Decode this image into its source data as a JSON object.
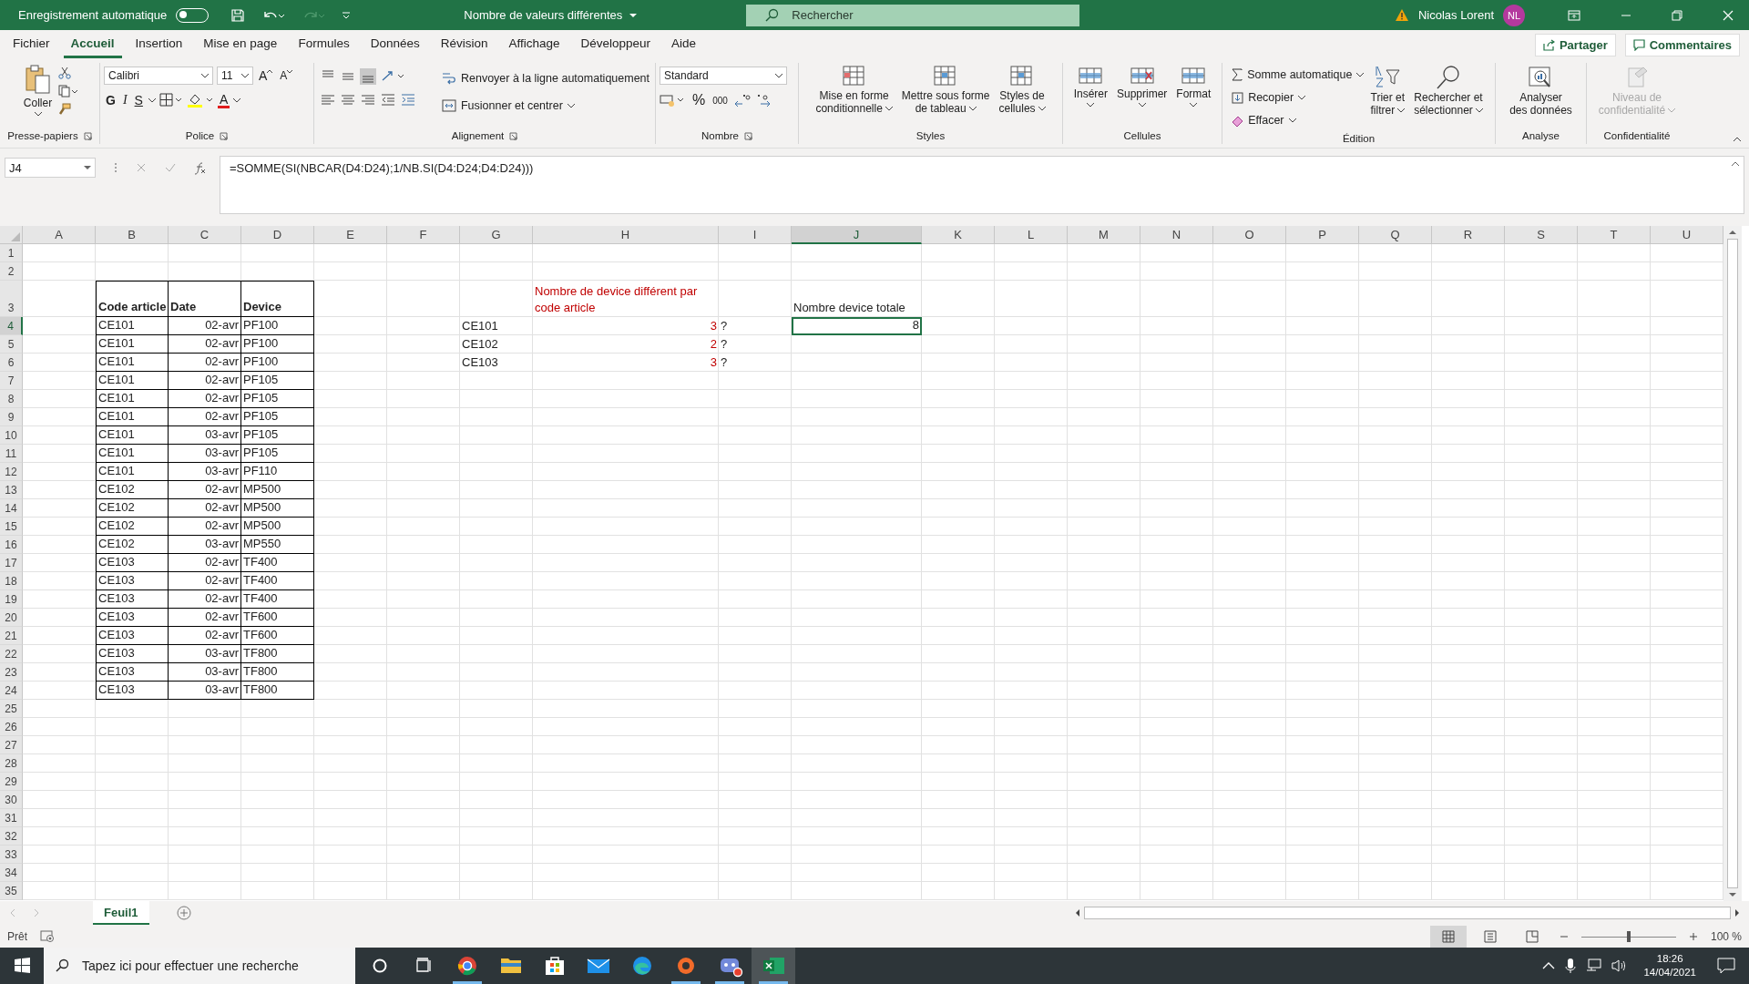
{
  "title_bar": {
    "autosave_label": "Enregistrement automatique",
    "autosave_on": false,
    "title": "Nombre de valeurs différentes",
    "search_placeholder": "Rechercher",
    "user_name": "Nicolas Lorent",
    "user_initials": "NL"
  },
  "menu_tabs": [
    {
      "label": "Fichier",
      "selected": false
    },
    {
      "label": "Accueil",
      "selected": true
    },
    {
      "label": "Insertion",
      "selected": false
    },
    {
      "label": "Mise en page",
      "selected": false
    },
    {
      "label": "Formules",
      "selected": false
    },
    {
      "label": "Données",
      "selected": false
    },
    {
      "label": "Révision",
      "selected": false
    },
    {
      "label": "Affichage",
      "selected": false
    },
    {
      "label": "Développeur",
      "selected": false
    },
    {
      "label": "Aide",
      "selected": false
    }
  ],
  "share_button": "Partager",
  "comments_button": "Commentaires",
  "ribbon": {
    "clipboard": {
      "paste": "Coller",
      "label": "Presse-papiers"
    },
    "font": {
      "family": "Calibri",
      "size": "11",
      "grow": "A",
      "shrink": "A",
      "bold": "G",
      "italic": "I",
      "underline": "S",
      "font_color": "A",
      "label": "Police"
    },
    "alignment": {
      "wrap": "Renvoyer à la ligne automatiquement",
      "merge": "Fusionner et centrer",
      "label": "Alignement"
    },
    "number": {
      "format": "Standard",
      "percent": "%",
      "thousands": "000",
      "label": "Nombre"
    },
    "styles": {
      "buttons": [
        {
          "lines": [
            "Mise en forme",
            "conditionnelle"
          ]
        },
        {
          "lines": [
            "Mettre sous forme",
            "de tableau"
          ]
        },
        {
          "lines": [
            "Styles de",
            "cellules"
          ]
        }
      ],
      "label": "Styles"
    },
    "cells": {
      "buttons": [
        "Insérer",
        "Supprimer",
        "Format"
      ],
      "label": "Cellules"
    },
    "editing": {
      "autosum": "Somme automatique",
      "fill": "Recopier",
      "clear": "Effacer",
      "sort": [
        "Trier et",
        "filtrer"
      ],
      "find": [
        "Rechercher et",
        "sélectionner"
      ],
      "label": "Édition"
    },
    "analysis": {
      "button": [
        "Analyser",
        "des données"
      ],
      "label": "Analyse"
    },
    "confidentiality": {
      "button": [
        "Niveau de",
        "confidentialité"
      ],
      "disabled": true,
      "label": "Confidentialité"
    }
  },
  "formula_bar": {
    "name_box": "J4",
    "formula": "=SOMME(SI(NBCAR(D4:D24);1/NB.SI(D4:D24;D4:D24)))"
  },
  "sheet": {
    "columns": [
      {
        "label": "A",
        "selected": false
      },
      {
        "label": "B",
        "selected": false
      },
      {
        "label": "C",
        "selected": false
      },
      {
        "label": "D",
        "selected": false
      },
      {
        "label": "E",
        "selected": false
      },
      {
        "label": "F",
        "selected": false
      },
      {
        "label": "G",
        "selected": false
      },
      {
        "label": "H",
        "selected": false
      },
      {
        "label": "I",
        "selected": false
      },
      {
        "label": "J",
        "selected": true
      },
      {
        "label": "K",
        "selected": false
      },
      {
        "label": "L",
        "selected": false
      },
      {
        "label": "M",
        "selected": false
      },
      {
        "label": "N",
        "selected": false
      },
      {
        "label": "O",
        "selected": false
      },
      {
        "label": "P",
        "selected": false
      },
      {
        "label": "Q",
        "selected": false
      },
      {
        "label": "R",
        "selected": false
      },
      {
        "label": "S",
        "selected": false
      },
      {
        "label": "T",
        "selected": false
      },
      {
        "label": "U",
        "selected": false
      }
    ],
    "rows": [
      {
        "header": "1",
        "selected": false
      },
      {
        "header": "2",
        "selected": false
      },
      {
        "header": "3",
        "selected": false
      },
      {
        "header": "4",
        "selected": true
      },
      {
        "header": "5",
        "selected": false
      },
      {
        "header": "6",
        "selected": false
      },
      {
        "header": "7",
        "selected": false
      },
      {
        "header": "8",
        "selected": false
      },
      {
        "header": "9",
        "selected": false
      },
      {
        "header": "10",
        "selected": false
      },
      {
        "header": "11",
        "selected": false
      },
      {
        "header": "12",
        "selected": false
      },
      {
        "header": "13",
        "selected": false
      },
      {
        "header": "14",
        "selected": false
      },
      {
        "header": "15",
        "selected": false
      },
      {
        "header": "16",
        "selected": false
      },
      {
        "header": "17",
        "selected": false
      },
      {
        "header": "18",
        "selected": false
      },
      {
        "header": "19",
        "selected": false
      },
      {
        "header": "20",
        "selected": false
      },
      {
        "header": "21",
        "selected": false
      },
      {
        "header": "22",
        "selected": false
      },
      {
        "header": "23",
        "selected": false
      },
      {
        "header": "24",
        "selected": false
      },
      {
        "header": "25",
        "selected": false
      },
      {
        "header": "26",
        "selected": false
      },
      {
        "header": "27",
        "selected": false
      },
      {
        "header": "28",
        "selected": false
      },
      {
        "header": "29",
        "selected": false
      },
      {
        "header": "30",
        "selected": false
      },
      {
        "header": "31",
        "selected": false
      },
      {
        "header": "32",
        "selected": false
      },
      {
        "header": "33",
        "selected": false
      },
      {
        "header": "34",
        "selected": false
      },
      {
        "header": "35",
        "selected": false
      }
    ],
    "data_table": {
      "headers": [
        "Code article",
        "Date",
        "Device"
      ],
      "rows": [
        {
          "code": "CE101",
          "date": "02-avr",
          "device": "PF100"
        },
        {
          "code": "CE101",
          "date": "02-avr",
          "device": "PF100"
        },
        {
          "code": "CE101",
          "date": "02-avr",
          "device": "PF100"
        },
        {
          "code": "CE101",
          "date": "02-avr",
          "device": "PF105"
        },
        {
          "code": "CE101",
          "date": "02-avr",
          "device": "PF105"
        },
        {
          "code": "CE101",
          "date": "02-avr",
          "device": "PF105"
        },
        {
          "code": "CE101",
          "date": "03-avr",
          "device": "PF105"
        },
        {
          "code": "CE101",
          "date": "03-avr",
          "device": "PF105"
        },
        {
          "code": "CE101",
          "date": "03-avr",
          "device": "PF110"
        },
        {
          "code": "CE102",
          "date": "02-avr",
          "device": "MP500"
        },
        {
          "code": "CE102",
          "date": "02-avr",
          "device": "MP500"
        },
        {
          "code": "CE102",
          "date": "02-avr",
          "device": "MP500"
        },
        {
          "code": "CE102",
          "date": "03-avr",
          "device": "MP550"
        },
        {
          "code": "CE103",
          "date": "02-avr",
          "device": "TF400"
        },
        {
          "code": "CE103",
          "date": "02-avr",
          "device": "TF400"
        },
        {
          "code": "CE103",
          "date": "02-avr",
          "device": "TF400"
        },
        {
          "code": "CE103",
          "date": "02-avr",
          "device": "TF600"
        },
        {
          "code": "CE103",
          "date": "02-avr",
          "device": "TF600"
        },
        {
          "code": "CE103",
          "date": "03-avr",
          "device": "TF800"
        },
        {
          "code": "CE103",
          "date": "03-avr",
          "device": "TF800"
        },
        {
          "code": "CE103",
          "date": "03-avr",
          "device": "TF800"
        }
      ]
    },
    "distinct_counts": {
      "title": "Nombre de device différent par code article",
      "rows": [
        {
          "code": "CE101",
          "count": "3",
          "note": "?"
        },
        {
          "code": "CE102",
          "count": "2",
          "note": "?"
        },
        {
          "code": "CE103",
          "count": "3",
          "note": "?"
        }
      ]
    },
    "total": {
      "label": "Nombre device totale",
      "value": "8",
      "selected": true
    }
  },
  "sheet_tabs": [
    {
      "label": "Feuil1",
      "selected": true
    }
  ],
  "status_bar": {
    "status": "Prêt",
    "zoom_slider": {
      "level": 0.5
    },
    "zoom": "100 %"
  },
  "taskbar": {
    "search_placeholder": "Tapez ici pour effectuer une recherche",
    "time": "18:26",
    "date": "14/04/2021"
  }
}
